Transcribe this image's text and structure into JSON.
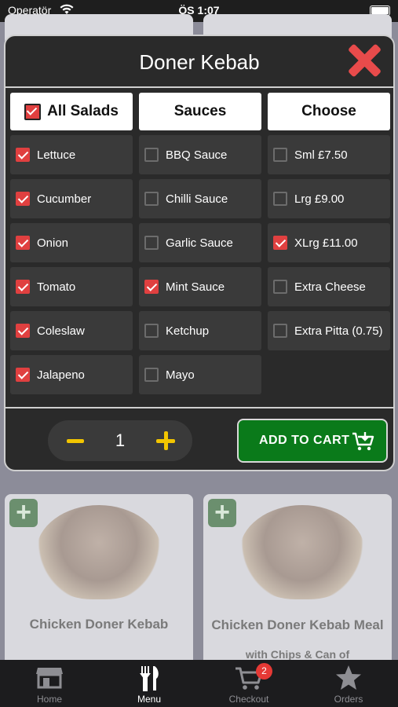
{
  "status_bar": {
    "carrier": "Operatör",
    "time": "ÖS 1:07"
  },
  "modal": {
    "title": "Doner Kebab",
    "columns": [
      {
        "header": "All Salads",
        "header_checked": true,
        "options": [
          {
            "label": "Lettuce",
            "checked": true
          },
          {
            "label": "Cucumber",
            "checked": true
          },
          {
            "label": "Onion",
            "checked": true
          },
          {
            "label": "Tomato",
            "checked": true
          },
          {
            "label": "Coleslaw",
            "checked": true
          },
          {
            "label": "Jalapeno",
            "checked": true
          }
        ]
      },
      {
        "header": "Sauces",
        "options": [
          {
            "label": "BBQ Sauce",
            "checked": false
          },
          {
            "label": "Chilli Sauce",
            "checked": false
          },
          {
            "label": "Garlic Sauce",
            "checked": false
          },
          {
            "label": "Mint Sauce",
            "checked": true
          },
          {
            "label": "Ketchup",
            "checked": false
          },
          {
            "label": "Mayo",
            "checked": false
          }
        ]
      },
      {
        "header": "Choose",
        "options": [
          {
            "label": "Sml £7.50",
            "checked": false
          },
          {
            "label": "Lrg £9.00",
            "checked": false
          },
          {
            "label": "XLrg £11.00",
            "checked": true
          },
          {
            "label": "Extra Cheese",
            "checked": false
          },
          {
            "label": "Extra Pitta (0.75)",
            "checked": false
          }
        ]
      }
    ],
    "quantity": "1",
    "add_to_cart_label": "ADD TO CART"
  },
  "background_menu": {
    "items": [
      {
        "title": "Chicken Doner Kebab",
        "subtitle": ""
      },
      {
        "title": "Chicken Doner Kebab Meal",
        "subtitle": "with Chips & Can of"
      }
    ]
  },
  "tab_bar": {
    "tabs": [
      {
        "label": "Home",
        "icon": "store-icon"
      },
      {
        "label": "Menu",
        "icon": "fork-knife-icon"
      },
      {
        "label": "Checkout",
        "icon": "cart-icon",
        "badge": "2"
      },
      {
        "label": "Orders",
        "icon": "star-icon"
      }
    ],
    "active": "Menu"
  },
  "colors": {
    "accent_check": "#e04040",
    "add_to_cart": "#0a7a1a",
    "stepper_icons": "#f2c500",
    "close": "#e84b4b"
  }
}
